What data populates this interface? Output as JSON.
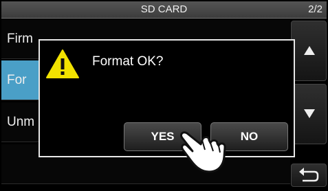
{
  "header": {
    "title": "SD CARD",
    "page": "2/2"
  },
  "list": {
    "items": [
      {
        "label": "Firm"
      },
      {
        "label": "For"
      },
      {
        "label": "Unm"
      }
    ]
  },
  "dialog": {
    "icon": "warning-icon",
    "message": "Format OK?",
    "yes_label": "YES",
    "no_label": "NO"
  },
  "side_buttons": [
    "scroll-up-icon",
    "scroll-down-icon",
    "return-icon"
  ],
  "colors": {
    "selected": "#4a9fc7",
    "warning": "#f2e200"
  }
}
